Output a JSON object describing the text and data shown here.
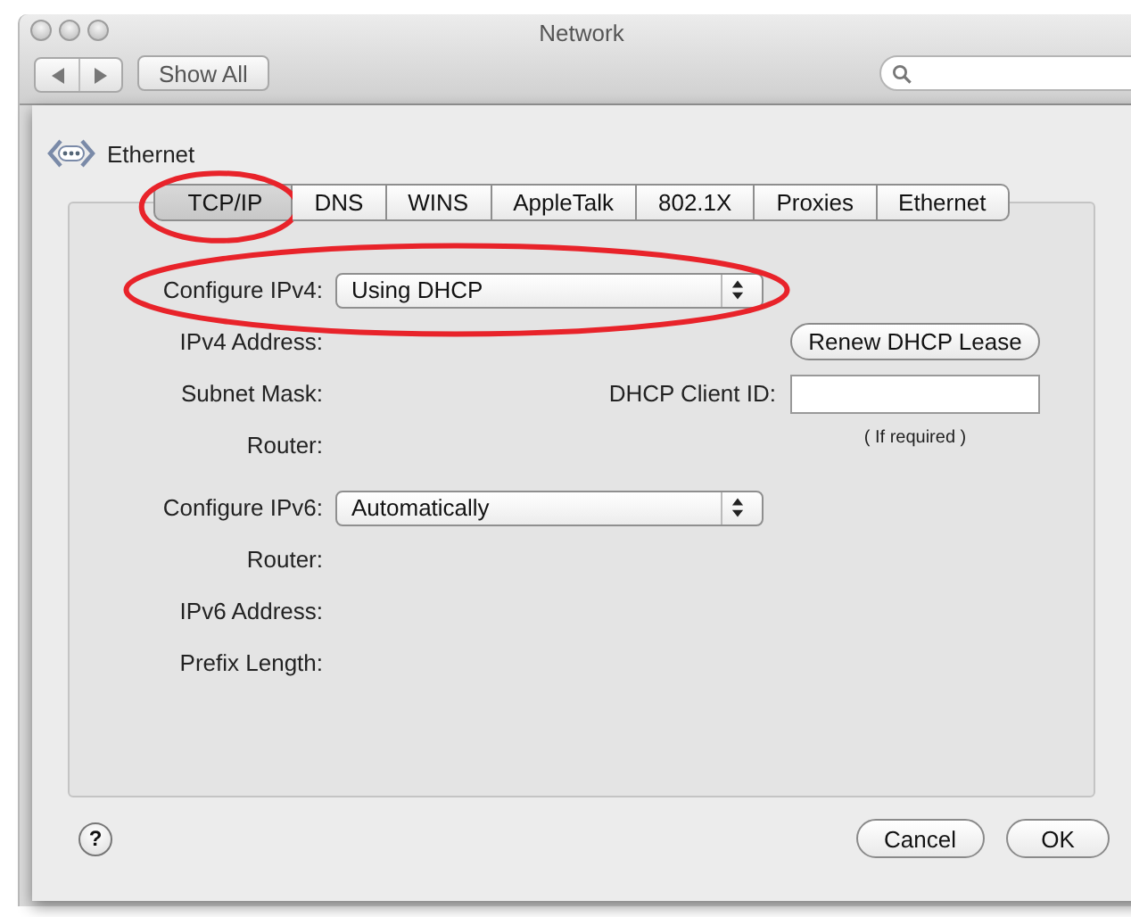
{
  "window": {
    "title": "Network"
  },
  "toolbar": {
    "show_all": "Show All"
  },
  "service": {
    "name": "Ethernet"
  },
  "tabs": [
    {
      "label": "TCP/IP",
      "selected": true,
      "circled": true
    },
    {
      "label": "DNS",
      "selected": false,
      "circled": false
    },
    {
      "label": "WINS",
      "selected": false,
      "circled": false
    },
    {
      "label": "AppleTalk",
      "selected": false,
      "circled": false
    },
    {
      "label": "802.1X",
      "selected": false,
      "circled": false
    },
    {
      "label": "Proxies",
      "selected": false,
      "circled": false
    },
    {
      "label": "Ethernet",
      "selected": false,
      "circled": false
    }
  ],
  "ipv4": {
    "label": "Configure IPv4:",
    "value": "Using DHCP",
    "circled": true
  },
  "ipv4_fields": [
    {
      "label": "IPv4 Address:"
    },
    {
      "label": "Subnet Mask:"
    },
    {
      "label": "Router:"
    }
  ],
  "renew_button": "Renew DHCP Lease",
  "client_id": {
    "label": "DHCP Client ID:",
    "note": "( If required )"
  },
  "ipv6": {
    "label": "Configure IPv6:",
    "value": "Automatically"
  },
  "ipv6_fields": [
    {
      "label": "Router:"
    },
    {
      "label": "IPv6 Address:"
    },
    {
      "label": "Prefix Length:"
    }
  ],
  "help": "?",
  "buttons": {
    "cancel": "Cancel",
    "ok": "OK"
  }
}
